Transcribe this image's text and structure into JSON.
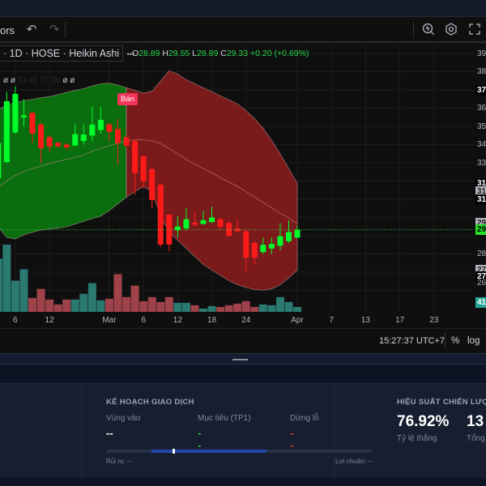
{
  "toolbar": {
    "indicators_label": "ors",
    "undo": "↶",
    "redo": "↷"
  },
  "legend": {
    "symbol_info": "· 1D · HOSE · Heikin Ashi",
    "more": "•••",
    "ohlc": {
      "o_label": "O",
      "o": "28.89",
      "h_label": "H",
      "h": "29.55",
      "l_label": "L",
      "l": "28.89",
      "c_label": "C",
      "c": "29.33",
      "change": "+0.20 (+0.69%)"
    }
  },
  "indicator_row": {
    "icon1": "ø",
    "icon2": "ø",
    "values": "31.41 27.06",
    "icon3": "ø",
    "icon4": "ø"
  },
  "signal": {
    "label": "Bán",
    "index": 15
  },
  "price_axis": [
    {
      "text": "39",
      "price": 39,
      "style": "plain"
    },
    {
      "text": "38",
      "price": 38,
      "style": "plain"
    },
    {
      "text": "37",
      "price": 37,
      "style": "black"
    },
    {
      "text": "36",
      "price": 36,
      "style": "plain"
    },
    {
      "text": "35",
      "price": 35,
      "style": "plain"
    },
    {
      "text": "34",
      "price": 34,
      "style": "plain"
    },
    {
      "text": "33",
      "price": 33,
      "style": "plain"
    },
    {
      "text": "31",
      "price": 31.86,
      "style": "black"
    },
    {
      "text": "31",
      "price": 31.41,
      "style": "gray"
    },
    {
      "text": "31",
      "price": 30.96,
      "style": "black"
    },
    {
      "text": "29",
      "price": 29.67,
      "style": "gray"
    },
    {
      "text": "29",
      "price": 29.33,
      "style": "green"
    },
    {
      "text": "28",
      "price": 28,
      "style": "plain"
    },
    {
      "text": "27",
      "price": 27.12,
      "style": "gray"
    },
    {
      "text": "27",
      "price": 26.75,
      "style": "black"
    },
    {
      "text": "26",
      "price": 26.4,
      "style": "plain"
    },
    {
      "text": "41",
      "price": null,
      "style": "teal"
    }
  ],
  "x_axis": [
    {
      "text": "6",
      "i": 2
    },
    {
      "text": "12",
      "i": 6
    },
    {
      "text": "Mar",
      "i": 13
    },
    {
      "text": "6",
      "i": 17
    },
    {
      "text": "12",
      "i": 21
    },
    {
      "text": "18",
      "i": 25
    },
    {
      "text": "24",
      "i": 29
    },
    {
      "text": "Apr",
      "i": 35
    },
    {
      "text": "7",
      "i": 39
    },
    {
      "text": "13",
      "i": 43
    },
    {
      "text": "17",
      "i": 47
    },
    {
      "text": "23",
      "i": 51
    }
  ],
  "status": {
    "time": "15:27:37 UTC+7",
    "percent": "%",
    "log": "log"
  },
  "colors": {
    "up": "#00ff2a",
    "down": "#ff1a1a",
    "vol_up": "#2a7a72",
    "vol_down": "#a0424a",
    "band_green": "#0a6e0e",
    "band_red": "#7a1a1a",
    "signal": "#f2345a"
  },
  "chart_data": {
    "type": "candlestick",
    "ylim": [
      25.5,
      39.5
    ],
    "current_price": 29.33,
    "candles": [
      [
        32.15,
        34.5,
        31.5,
        34.08
      ],
      [
        33.04,
        36.9,
        33.0,
        36.38
      ],
      [
        34.67,
        37.2,
        34.6,
        36.78
      ],
      [
        35.5,
        36.5,
        35.0,
        35.6
      ],
      [
        35.74,
        35.8,
        34.1,
        34.6
      ],
      [
        35.1,
        35.2,
        33.0,
        33.8
      ],
      [
        34.4,
        34.5,
        33.6,
        33.9
      ],
      [
        34.1,
        34.15,
        33.85,
        33.9
      ],
      [
        34.0,
        34.1,
        33.7,
        33.85
      ],
      [
        33.95,
        35.1,
        33.9,
        34.57
      ],
      [
        34.2,
        35.1,
        34.0,
        34.55
      ],
      [
        34.5,
        36.1,
        34.2,
        35.1
      ],
      [
        34.8,
        36.05,
        34.6,
        35.35
      ],
      [
        35.1,
        35.2,
        34.2,
        34.7
      ],
      [
        34.85,
        35.4,
        32.9,
        34.08
      ],
      [
        34.4,
        34.5,
        33.8,
        33.95
      ],
      [
        34.2,
        34.3,
        31.26,
        32.45
      ],
      [
        33.35,
        33.4,
        31.6,
        32.0
      ],
      [
        32.65,
        32.7,
        30.5,
        30.96
      ],
      [
        31.8,
        31.9,
        28.37,
        28.52
      ],
      [
        30.15,
        30.2,
        28.15,
        28.52
      ],
      [
        29.3,
        30.1,
        28.9,
        29.5
      ],
      [
        29.4,
        30.5,
        29.3,
        29.9
      ],
      [
        29.72,
        30.3,
        29.5,
        29.6
      ],
      [
        29.65,
        30.35,
        29.6,
        29.85
      ],
      [
        29.75,
        30.6,
        29.7,
        30.0
      ],
      [
        29.9,
        30.0,
        29.3,
        29.5
      ],
      [
        29.7,
        29.85,
        28.95,
        29.0
      ],
      [
        29.4,
        29.9,
        29.2,
        29.25
      ],
      [
        29.25,
        29.3,
        27.0,
        27.8
      ],
      [
        28.6,
        28.7,
        27.4,
        27.8
      ],
      [
        28.1,
        28.9,
        28.0,
        28.5
      ],
      [
        28.3,
        28.9,
        28.0,
        28.55
      ],
      [
        28.45,
        29.7,
        28.2,
        28.97
      ],
      [
        28.7,
        29.85,
        28.6,
        29.2
      ],
      [
        28.89,
        29.55,
        28.89,
        29.33
      ]
    ],
    "volume": [
      65,
      82,
      38,
      52,
      17,
      28,
      15,
      9,
      15,
      15,
      22,
      35,
      14,
      16,
      46,
      18,
      32,
      13,
      18,
      12,
      18,
      11,
      11,
      8,
      4,
      7,
      6,
      8,
      10,
      13,
      6,
      9,
      8,
      18,
      12,
      6
    ],
    "band_upper": [
      35.93,
      36.16,
      36.3,
      36.41,
      36.48,
      36.57,
      36.63,
      36.75,
      36.87,
      36.97,
      37.07,
      37.22,
      37.34,
      37.37,
      37.27,
      37.12,
      36.97,
      36.82,
      36.93,
      37.49,
      38.05,
      37.86,
      37.56,
      37.34,
      37.12,
      36.9,
      36.67,
      36.45,
      36.23,
      35.86,
      35.42,
      34.9,
      34.23,
      33.49,
      32.68,
      31.86
    ],
    "band_lower": [
      29.49,
      28.9,
      28.82,
      29.05,
      29.19,
      29.31,
      29.37,
      29.42,
      29.49,
      29.64,
      29.79,
      29.94,
      30.08,
      30.38,
      30.75,
      31.12,
      31.42,
      31.71,
      31.42,
      30.08,
      29.19,
      28.75,
      28.31,
      27.86,
      27.42,
      27.12,
      26.82,
      26.53,
      26.31,
      26.16,
      26.05,
      26.01,
      26.08,
      26.31,
      26.68,
      27.12
    ],
    "band_basis": [
      31.64,
      32.01,
      32.31,
      32.53,
      32.68,
      32.82,
      32.97,
      33.08,
      33.19,
      33.3,
      33.42,
      33.64,
      33.79,
      33.94,
      34.08,
      34.2,
      34.26,
      34.26,
      34.2,
      34.05,
      33.79,
      33.49,
      33.19,
      32.93,
      32.68,
      32.45,
      32.19,
      31.94,
      31.71,
      31.42,
      31.12,
      30.82,
      30.53,
      30.23,
      29.97,
      29.67
    ]
  },
  "trade_plan": {
    "title": "KẾ HOẠCH GIAO DỊCH",
    "entry_label": "Vùng vào",
    "entry": "--",
    "target_label": "Mục tiêu (TP1)",
    "target": "--",
    "stop_label": "Dừng lỗ",
    "stop": "--",
    "risk": "Rủi ro: --",
    "reward": "Lợi nhuận: --"
  },
  "performance": {
    "title": "HIỆU SUẤT CHIẾN LƯỢC",
    "win_rate": "76.92%",
    "win_rate_label": "Tỷ lệ thắng",
    "total": "13",
    "total_label": "Tổng"
  }
}
